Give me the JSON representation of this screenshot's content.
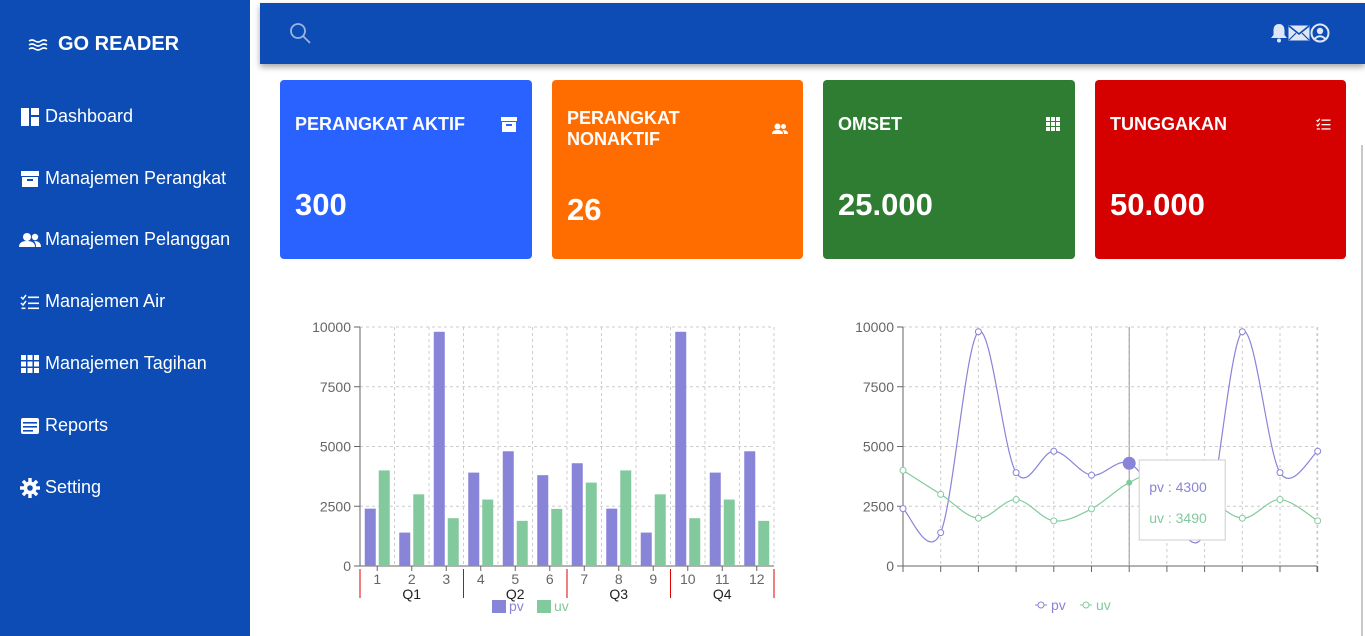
{
  "brand": {
    "name": "GO READER"
  },
  "sidebar": {
    "items": [
      {
        "label": "Dashboard",
        "icon": "dashboard-icon"
      },
      {
        "label": "Manajemen Perangkat",
        "icon": "archive-icon"
      },
      {
        "label": "Manajemen Pelanggan",
        "icon": "users-icon"
      },
      {
        "label": "Manajemen Air",
        "icon": "list-check-icon"
      },
      {
        "label": "Manajemen Tagihan",
        "icon": "grid-icon"
      },
      {
        "label": "Reports",
        "icon": "reports-icon"
      },
      {
        "label": "Setting",
        "icon": "gear-icon"
      }
    ]
  },
  "topbar": {
    "icons": [
      "search-icon",
      "bell-icon",
      "mail-icon",
      "user-circle-icon"
    ]
  },
  "cards": [
    {
      "title": "PERANGKAT AKTIF",
      "value": "300",
      "color": "#2962ff",
      "icon": "archive-icon"
    },
    {
      "title_line1": "PERANGKAT",
      "title_line2": "NONAKTIF",
      "value": "26",
      "color": "#ff6d00",
      "icon": "users-icon"
    },
    {
      "title": "OMSET",
      "value": "25.000",
      "color": "#2e7d32",
      "icon": "grid-icon"
    },
    {
      "title": "TUNGGAKAN",
      "value": "50.000",
      "color": "#d50000",
      "icon": "list-check-icon"
    }
  ],
  "chart_data": [
    {
      "type": "bar",
      "categories": [
        "1",
        "2",
        "3",
        "4",
        "5",
        "6",
        "7",
        "8",
        "9",
        "10",
        "11",
        "12"
      ],
      "groups": [
        "Q1",
        "Q2",
        "Q3",
        "Q4"
      ],
      "series": [
        {
          "name": "pv",
          "color": "#8884d8",
          "values": [
            2400,
            1398,
            9800,
            3908,
            4800,
            3800,
            4300,
            2400,
            1398,
            9800,
            3908,
            4800
          ]
        },
        {
          "name": "uv",
          "color": "#82ca9d",
          "values": [
            4000,
            3000,
            2000,
            2780,
            1890,
            2390,
            3490,
            4000,
            3000,
            2000,
            2780,
            1890
          ]
        }
      ],
      "yticks": [
        "0",
        "2500",
        "5000",
        "7500",
        "10000"
      ],
      "ylim": [
        0,
        10000
      ],
      "grid": true,
      "legend": "bottom"
    },
    {
      "type": "line",
      "series": [
        {
          "name": "pv",
          "color": "#8884d8",
          "values": [
            2400,
            1398,
            9800,
            3908,
            4800,
            3800,
            4300,
            2400,
            1398,
            9800,
            3908,
            4800
          ]
        },
        {
          "name": "uv",
          "color": "#82ca9d",
          "values": [
            4000,
            3000,
            2000,
            2780,
            1890,
            2390,
            3490,
            4000,
            3000,
            2000,
            2780,
            1890
          ]
        }
      ],
      "yticks": [
        "0",
        "2500",
        "5000",
        "7500",
        "10000"
      ],
      "ylim": [
        0,
        10000
      ],
      "grid": true,
      "legend": "bottom",
      "tooltip": {
        "pv": "pv : 4300",
        "uv": "uv : 3490"
      }
    }
  ]
}
